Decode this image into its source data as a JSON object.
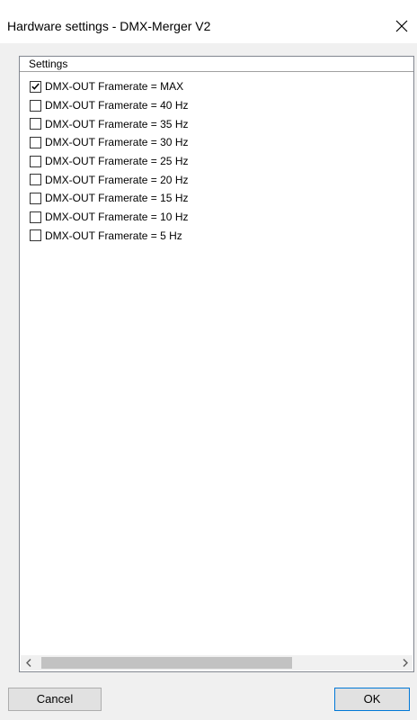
{
  "window": {
    "title": "Hardware settings - DMX-Merger V2"
  },
  "list": {
    "column_header": "Settings",
    "items": [
      {
        "label": "DMX-OUT Framerate = MAX",
        "checked": true
      },
      {
        "label": "DMX-OUT Framerate = 40 Hz",
        "checked": false
      },
      {
        "label": "DMX-OUT Framerate = 35 Hz",
        "checked": false
      },
      {
        "label": "DMX-OUT Framerate = 30 Hz",
        "checked": false
      },
      {
        "label": "DMX-OUT Framerate = 25 Hz",
        "checked": false
      },
      {
        "label": "DMX-OUT Framerate = 20 Hz",
        "checked": false
      },
      {
        "label": "DMX-OUT Framerate = 15 Hz",
        "checked": false
      },
      {
        "label": "DMX-OUT Framerate = 10 Hz",
        "checked": false
      },
      {
        "label": "DMX-OUT Framerate = 5 Hz",
        "checked": false
      }
    ]
  },
  "buttons": {
    "cancel_label": "Cancel",
    "ok_label": "OK"
  },
  "icons": {
    "close": "close-icon",
    "checkmark": "checkmark-icon",
    "scroll_left": "chevron-left-icon",
    "scroll_right": "chevron-right-icon"
  },
  "colors": {
    "ok_border": "#0078d7",
    "list_border": "#828790",
    "scroll_thumb": "#c2c2c2"
  }
}
